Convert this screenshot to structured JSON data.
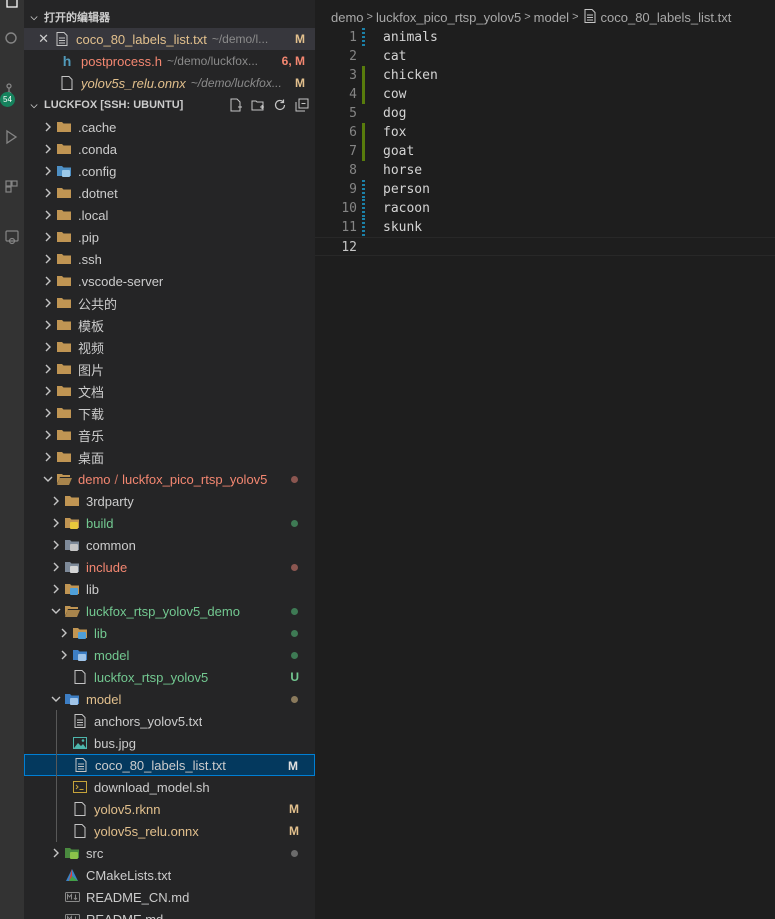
{
  "colors": {
    "modified": "#e2c08d",
    "error": "#f48771",
    "untracked": "#73c991",
    "ignored": "#8c8c8c",
    "selection": "#04395e",
    "focus_border": "#007fd4",
    "badge": "#16825d"
  },
  "activity": {
    "badge": "54",
    "icons": [
      "search-icon",
      "source-control-icon",
      "run-debug-icon",
      "extensions-icon",
      "remote-explorer-icon"
    ]
  },
  "open_editors": {
    "title": "打开的编辑器",
    "items": [
      {
        "name": "coco_80_labels_list.txt",
        "path": "~/demo/l...",
        "status": "M",
        "icon": "text-file-icon"
      },
      {
        "name": "postprocess.h",
        "path": "~/demo/luckfox...",
        "status": "6, M",
        "icon": "c-header-icon"
      },
      {
        "name": "yolov5s_relu.onnx",
        "path": "~/demo/luckfox...",
        "status": "M",
        "icon": "generic-file-icon"
      }
    ]
  },
  "explorer": {
    "title": "LUCKFOX [SSH: UBUNTU]",
    "actions": [
      "new-file-icon",
      "new-folder-icon",
      "refresh-icon",
      "collapse-all-icon"
    ],
    "items": [
      {
        "label": ".cache",
        "kind": "folder"
      },
      {
        "label": ".conda",
        "kind": "folder"
      },
      {
        "label": ".config",
        "kind": "folder-config"
      },
      {
        "label": ".dotnet",
        "kind": "folder"
      },
      {
        "label": ".local",
        "kind": "folder"
      },
      {
        "label": ".pip",
        "kind": "folder"
      },
      {
        "label": ".ssh",
        "kind": "folder"
      },
      {
        "label": ".vscode-server",
        "kind": "folder"
      },
      {
        "label": "公共的",
        "kind": "folder"
      },
      {
        "label": "模板",
        "kind": "folder"
      },
      {
        "label": "视频",
        "kind": "folder"
      },
      {
        "label": "图片",
        "kind": "folder"
      },
      {
        "label": "文档",
        "kind": "folder"
      },
      {
        "label": "下载",
        "kind": "folder"
      },
      {
        "label": "音乐",
        "kind": "folder"
      },
      {
        "label": "桌面",
        "kind": "folder"
      },
      {
        "label": "demo",
        "label2": "luckfox_pico_rtsp_yolov5",
        "sep": "/",
        "kind": "folder-open"
      },
      {
        "label": "3rdparty",
        "kind": "folder"
      },
      {
        "label": "build",
        "kind": "folder-build"
      },
      {
        "label": "common",
        "kind": "folder-common"
      },
      {
        "label": "include",
        "kind": "folder-include"
      },
      {
        "label": "lib",
        "kind": "folder-lib"
      },
      {
        "label": "luckfox_rtsp_yolov5_demo",
        "kind": "folder-open"
      },
      {
        "label": "lib",
        "kind": "folder-lib"
      },
      {
        "label": "model",
        "kind": "folder-model"
      },
      {
        "label": "luckfox_rtsp_yolov5",
        "kind": "file",
        "deco": "U"
      },
      {
        "label": "model",
        "kind": "folder-model-open"
      },
      {
        "label": "anchors_yolov5.txt",
        "kind": "text-file"
      },
      {
        "label": "bus.jpg",
        "kind": "image-file"
      },
      {
        "label": "coco_80_labels_list.txt",
        "kind": "text-file",
        "deco": "M"
      },
      {
        "label": "download_model.sh",
        "kind": "shell-file"
      },
      {
        "label": "yolov5.rknn",
        "kind": "file",
        "deco": "M"
      },
      {
        "label": "yolov5s_relu.onnx",
        "kind": "file",
        "deco": "M"
      },
      {
        "label": "src",
        "kind": "folder-src"
      },
      {
        "label": "CMakeLists.txt",
        "kind": "cmake-file"
      },
      {
        "label": "README_CN.md",
        "kind": "markdown-file"
      },
      {
        "label": "README.md",
        "kind": "markdown-file"
      }
    ]
  },
  "breadcrumb": [
    "demo",
    "luckfox_pico_rtsp_yolov5",
    "model",
    "coco_80_labels_list.txt"
  ],
  "editor": {
    "lines": [
      {
        "n": "1",
        "text": "animals",
        "gutter": "mod"
      },
      {
        "n": "2",
        "text": "cat",
        "gutter": ""
      },
      {
        "n": "3",
        "text": "chicken",
        "gutter": "add"
      },
      {
        "n": "4",
        "text": "cow",
        "gutter": "add"
      },
      {
        "n": "5",
        "text": "dog",
        "gutter": ""
      },
      {
        "n": "6",
        "text": "fox",
        "gutter": "add"
      },
      {
        "n": "7",
        "text": "goat",
        "gutter": "add"
      },
      {
        "n": "8",
        "text": "horse",
        "gutter": ""
      },
      {
        "n": "9",
        "text": "person",
        "gutter": "mod"
      },
      {
        "n": "10",
        "text": "racoon",
        "gutter": "mod"
      },
      {
        "n": "11",
        "text": "skunk",
        "gutter": "mod"
      },
      {
        "n": "12",
        "text": "",
        "gutter": ""
      }
    ]
  }
}
